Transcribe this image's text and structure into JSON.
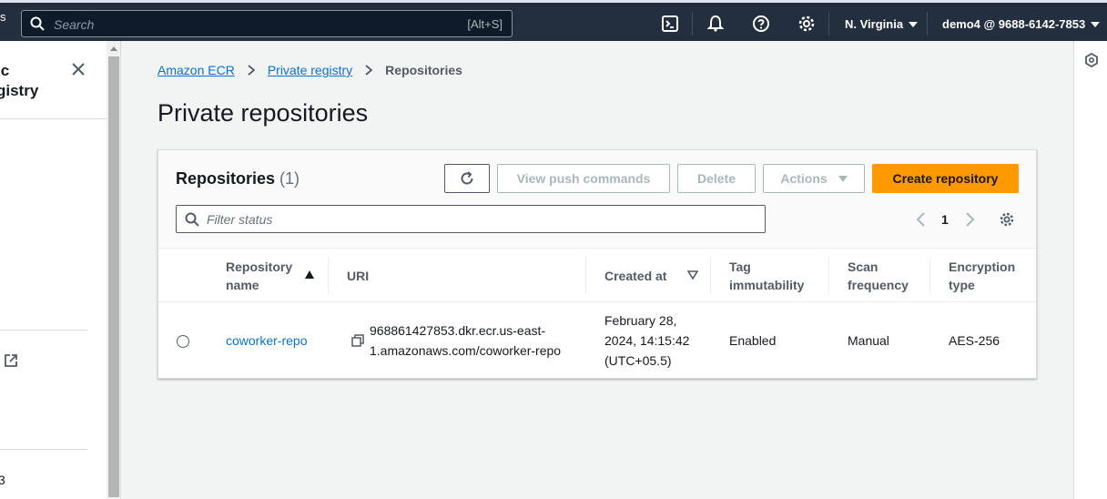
{
  "topnav": {
    "left_fragment": "s",
    "search_placeholder": "Search",
    "search_shortcut": "[Alt+S]",
    "region": "N. Virginia",
    "account": "demo4 @ 9688-6142-7853"
  },
  "drawer": {
    "title_line1": "ic",
    "title_line2": "gistry",
    "bottom_fragment": "3"
  },
  "breadcrumb": {
    "items": [
      "Amazon ECR",
      "Private registry"
    ],
    "current": "Repositories"
  },
  "page": {
    "title": "Private repositories"
  },
  "container": {
    "heading": "Repositories",
    "count": "(1)",
    "buttons": {
      "view_push": "View push commands",
      "delete": "Delete",
      "actions": "Actions",
      "create": "Create repository"
    },
    "filter_placeholder": "Filter status",
    "page_number": "1"
  },
  "table": {
    "headers": {
      "repo_name_1": "Repository",
      "repo_name_2": "name",
      "uri": "URI",
      "created_at": "Created at",
      "tag_imm_1": "Tag",
      "tag_imm_2": "immutability",
      "scan_1": "Scan",
      "scan_2": "frequency",
      "enc_1": "Encryption",
      "enc_2": "type"
    },
    "rows": [
      {
        "name": "coworker-repo",
        "uri_1": "968861427853.dkr.ecr.us-east-",
        "uri_2": "1.amazonaws.com/coworker-repo",
        "created_1": "February 28,",
        "created_2": "2024, 14:15:42",
        "created_3": "(UTC+05.5)",
        "tag_immutability": "Enabled",
        "scan_frequency": "Manual",
        "encryption_type": "AES-256"
      }
    ]
  },
  "colors": {
    "nav_bg": "#232f3e",
    "primary": "#ff9900",
    "link": "#0972d3"
  }
}
